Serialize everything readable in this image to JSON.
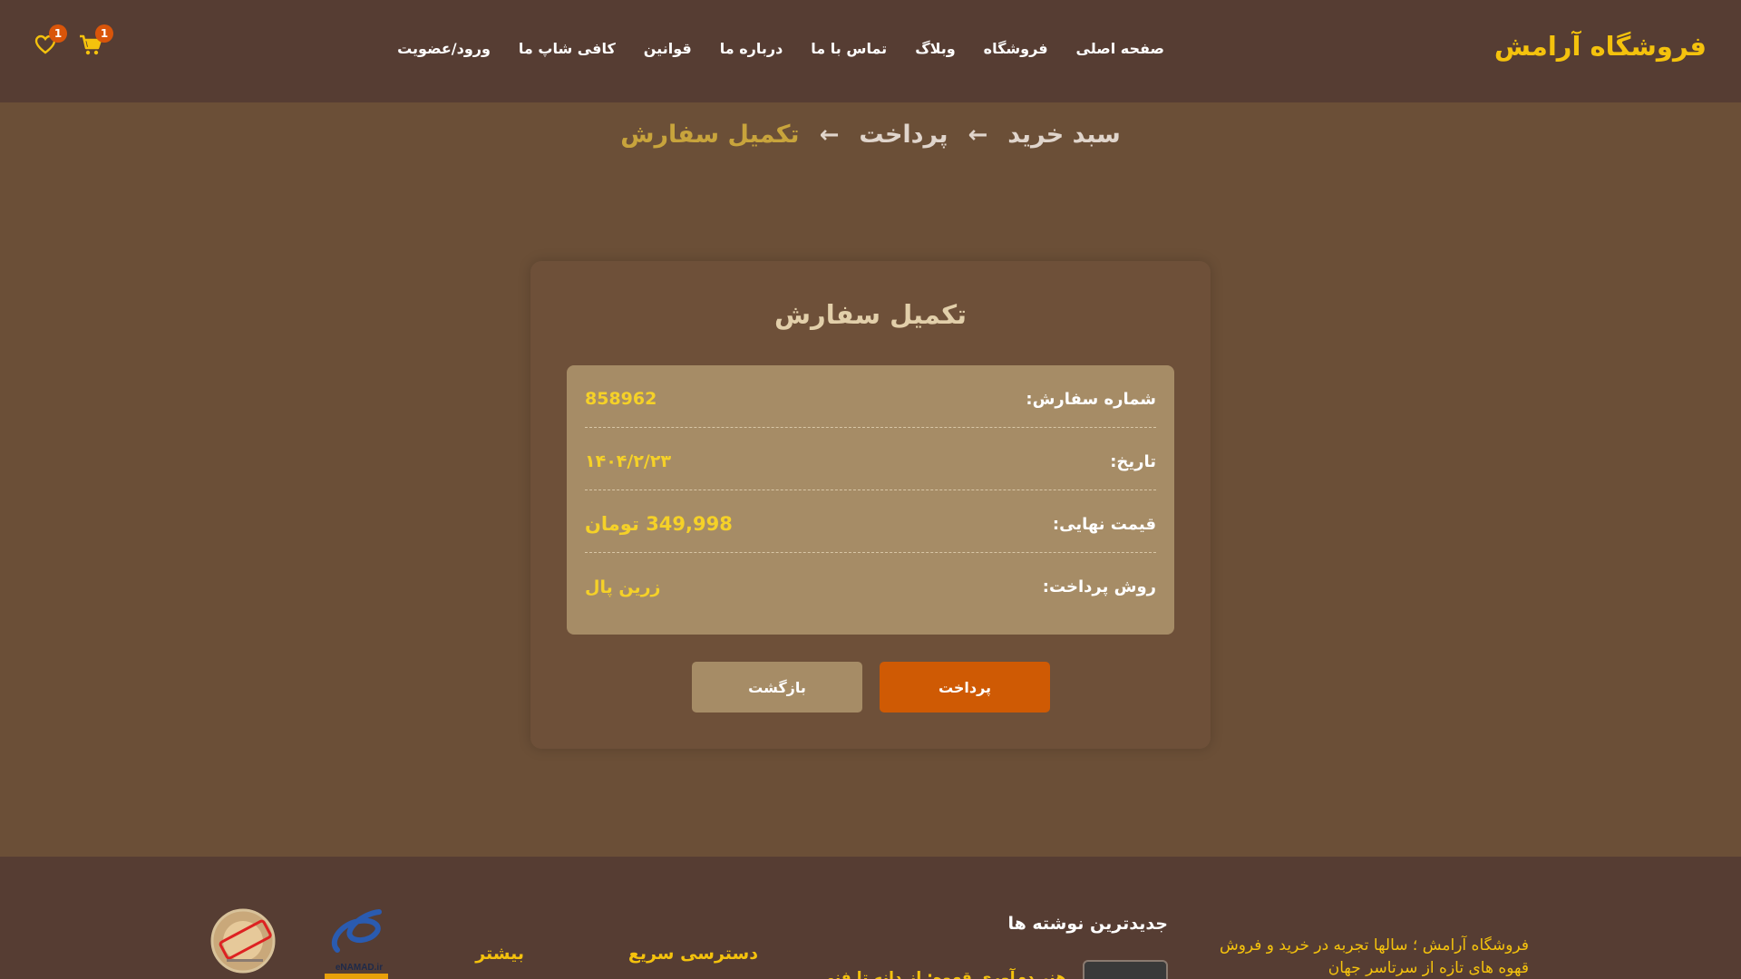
{
  "header": {
    "brand": "فروشگاه آرامش",
    "nav": [
      "صفحه اصلی",
      "فروشگاه",
      "وبلاگ",
      "تماس با ما",
      "درباره ما",
      "قوانین",
      "کافی شاپ ما",
      "ورود/عضویت"
    ],
    "cart_count": "1",
    "wishlist_count": "1",
    "cart_icon": "cart-icon",
    "wishlist_icon": "heart-icon"
  },
  "steps": [
    "سبد خرید",
    "پرداخت",
    "تکمیل سفارش"
  ],
  "active_step": 2,
  "card": {
    "title": "تکمیل سفارش",
    "rows": [
      {
        "label": "شماره سفارش:",
        "value": "858962"
      },
      {
        "label": "تاریخ:",
        "value": "۱۴۰۴/۲/۲۳"
      },
      {
        "label": "قیمت نهایی:",
        "value": "349,998 تومان"
      },
      {
        "label": "روش پرداخت:",
        "value": "زرین پال"
      }
    ],
    "pay_button": "پرداخت",
    "back_button": "بازگشت"
  },
  "footer": {
    "about": "فروشگاه آرامش ؛ سالها تجربه در خرید و فروش قهوه های تازه از سرتاسر جهان",
    "latest_heading": "جدیدترین نوشته ها",
    "latest_post": "هنر دم‌آوری قهوه: از دانه تا فنی",
    "quick_heading": "دسترسی سریع",
    "more_heading": "بیشتر",
    "enamad_text": "eNAMAD.ir"
  },
  "colors": {
    "header_bg": "#563d33",
    "page_bg": "#6b4f37",
    "accent": "#f4c20d",
    "pay_button": "#cf5a04",
    "info_box": "#a68c66"
  }
}
